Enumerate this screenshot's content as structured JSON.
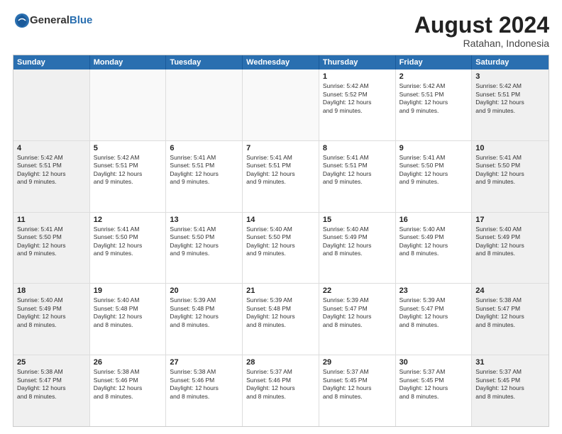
{
  "logo": {
    "general": "General",
    "blue": "Blue"
  },
  "title": "August 2024",
  "location": "Ratahan, Indonesia",
  "days_of_week": [
    "Sunday",
    "Monday",
    "Tuesday",
    "Wednesday",
    "Thursday",
    "Friday",
    "Saturday"
  ],
  "weeks": [
    [
      {
        "day": "",
        "info": ""
      },
      {
        "day": "",
        "info": ""
      },
      {
        "day": "",
        "info": ""
      },
      {
        "day": "",
        "info": ""
      },
      {
        "day": "1",
        "info": "Sunrise: 5:42 AM\nSunset: 5:52 PM\nDaylight: 12 hours\nand 9 minutes."
      },
      {
        "day": "2",
        "info": "Sunrise: 5:42 AM\nSunset: 5:51 PM\nDaylight: 12 hours\nand 9 minutes."
      },
      {
        "day": "3",
        "info": "Sunrise: 5:42 AM\nSunset: 5:51 PM\nDaylight: 12 hours\nand 9 minutes."
      }
    ],
    [
      {
        "day": "4",
        "info": "Sunrise: 5:42 AM\nSunset: 5:51 PM\nDaylight: 12 hours\nand 9 minutes."
      },
      {
        "day": "5",
        "info": "Sunrise: 5:42 AM\nSunset: 5:51 PM\nDaylight: 12 hours\nand 9 minutes."
      },
      {
        "day": "6",
        "info": "Sunrise: 5:41 AM\nSunset: 5:51 PM\nDaylight: 12 hours\nand 9 minutes."
      },
      {
        "day": "7",
        "info": "Sunrise: 5:41 AM\nSunset: 5:51 PM\nDaylight: 12 hours\nand 9 minutes."
      },
      {
        "day": "8",
        "info": "Sunrise: 5:41 AM\nSunset: 5:51 PM\nDaylight: 12 hours\nand 9 minutes."
      },
      {
        "day": "9",
        "info": "Sunrise: 5:41 AM\nSunset: 5:50 PM\nDaylight: 12 hours\nand 9 minutes."
      },
      {
        "day": "10",
        "info": "Sunrise: 5:41 AM\nSunset: 5:50 PM\nDaylight: 12 hours\nand 9 minutes."
      }
    ],
    [
      {
        "day": "11",
        "info": "Sunrise: 5:41 AM\nSunset: 5:50 PM\nDaylight: 12 hours\nand 9 minutes."
      },
      {
        "day": "12",
        "info": "Sunrise: 5:41 AM\nSunset: 5:50 PM\nDaylight: 12 hours\nand 9 minutes."
      },
      {
        "day": "13",
        "info": "Sunrise: 5:41 AM\nSunset: 5:50 PM\nDaylight: 12 hours\nand 9 minutes."
      },
      {
        "day": "14",
        "info": "Sunrise: 5:40 AM\nSunset: 5:50 PM\nDaylight: 12 hours\nand 9 minutes."
      },
      {
        "day": "15",
        "info": "Sunrise: 5:40 AM\nSunset: 5:49 PM\nDaylight: 12 hours\nand 8 minutes."
      },
      {
        "day": "16",
        "info": "Sunrise: 5:40 AM\nSunset: 5:49 PM\nDaylight: 12 hours\nand 8 minutes."
      },
      {
        "day": "17",
        "info": "Sunrise: 5:40 AM\nSunset: 5:49 PM\nDaylight: 12 hours\nand 8 minutes."
      }
    ],
    [
      {
        "day": "18",
        "info": "Sunrise: 5:40 AM\nSunset: 5:49 PM\nDaylight: 12 hours\nand 8 minutes."
      },
      {
        "day": "19",
        "info": "Sunrise: 5:40 AM\nSunset: 5:48 PM\nDaylight: 12 hours\nand 8 minutes."
      },
      {
        "day": "20",
        "info": "Sunrise: 5:39 AM\nSunset: 5:48 PM\nDaylight: 12 hours\nand 8 minutes."
      },
      {
        "day": "21",
        "info": "Sunrise: 5:39 AM\nSunset: 5:48 PM\nDaylight: 12 hours\nand 8 minutes."
      },
      {
        "day": "22",
        "info": "Sunrise: 5:39 AM\nSunset: 5:47 PM\nDaylight: 12 hours\nand 8 minutes."
      },
      {
        "day": "23",
        "info": "Sunrise: 5:39 AM\nSunset: 5:47 PM\nDaylight: 12 hours\nand 8 minutes."
      },
      {
        "day": "24",
        "info": "Sunrise: 5:38 AM\nSunset: 5:47 PM\nDaylight: 12 hours\nand 8 minutes."
      }
    ],
    [
      {
        "day": "25",
        "info": "Sunrise: 5:38 AM\nSunset: 5:47 PM\nDaylight: 12 hours\nand 8 minutes."
      },
      {
        "day": "26",
        "info": "Sunrise: 5:38 AM\nSunset: 5:46 PM\nDaylight: 12 hours\nand 8 minutes."
      },
      {
        "day": "27",
        "info": "Sunrise: 5:38 AM\nSunset: 5:46 PM\nDaylight: 12 hours\nand 8 minutes."
      },
      {
        "day": "28",
        "info": "Sunrise: 5:37 AM\nSunset: 5:46 PM\nDaylight: 12 hours\nand 8 minutes."
      },
      {
        "day": "29",
        "info": "Sunrise: 5:37 AM\nSunset: 5:45 PM\nDaylight: 12 hours\nand 8 minutes."
      },
      {
        "day": "30",
        "info": "Sunrise: 5:37 AM\nSunset: 5:45 PM\nDaylight: 12 hours\nand 8 minutes."
      },
      {
        "day": "31",
        "info": "Sunrise: 5:37 AM\nSunset: 5:45 PM\nDaylight: 12 hours\nand 8 minutes."
      }
    ]
  ]
}
